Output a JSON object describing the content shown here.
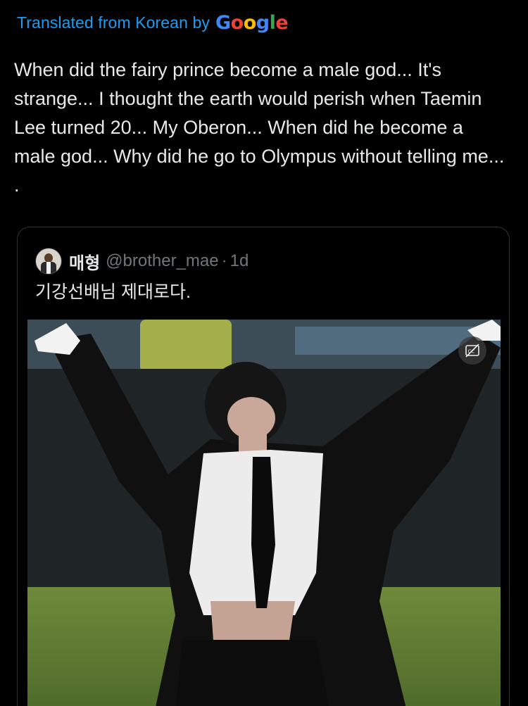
{
  "translation": {
    "label": "Translated from Korean by",
    "provider": "Google"
  },
  "tweet": {
    "text": "When did the fairy prince become a male god... It's strange... I thought the earth would perish when Taemin Lee turned 20... My Oberon... When did he become a male god... Why did he go to Olympus without telling me... ."
  },
  "quote": {
    "display_name": "매형",
    "handle": "@brother_mae",
    "separator": "·",
    "time": "1d",
    "text": "기강선배님 제대로다.",
    "avatar_icon": "user-avatar",
    "media_badge_icon": "closed-captions-icon"
  },
  "colors": {
    "background": "#000000",
    "text": "#e7e9ea",
    "secondary": "#71767b",
    "link": "#1d9bf0",
    "border": "#2f3336"
  }
}
